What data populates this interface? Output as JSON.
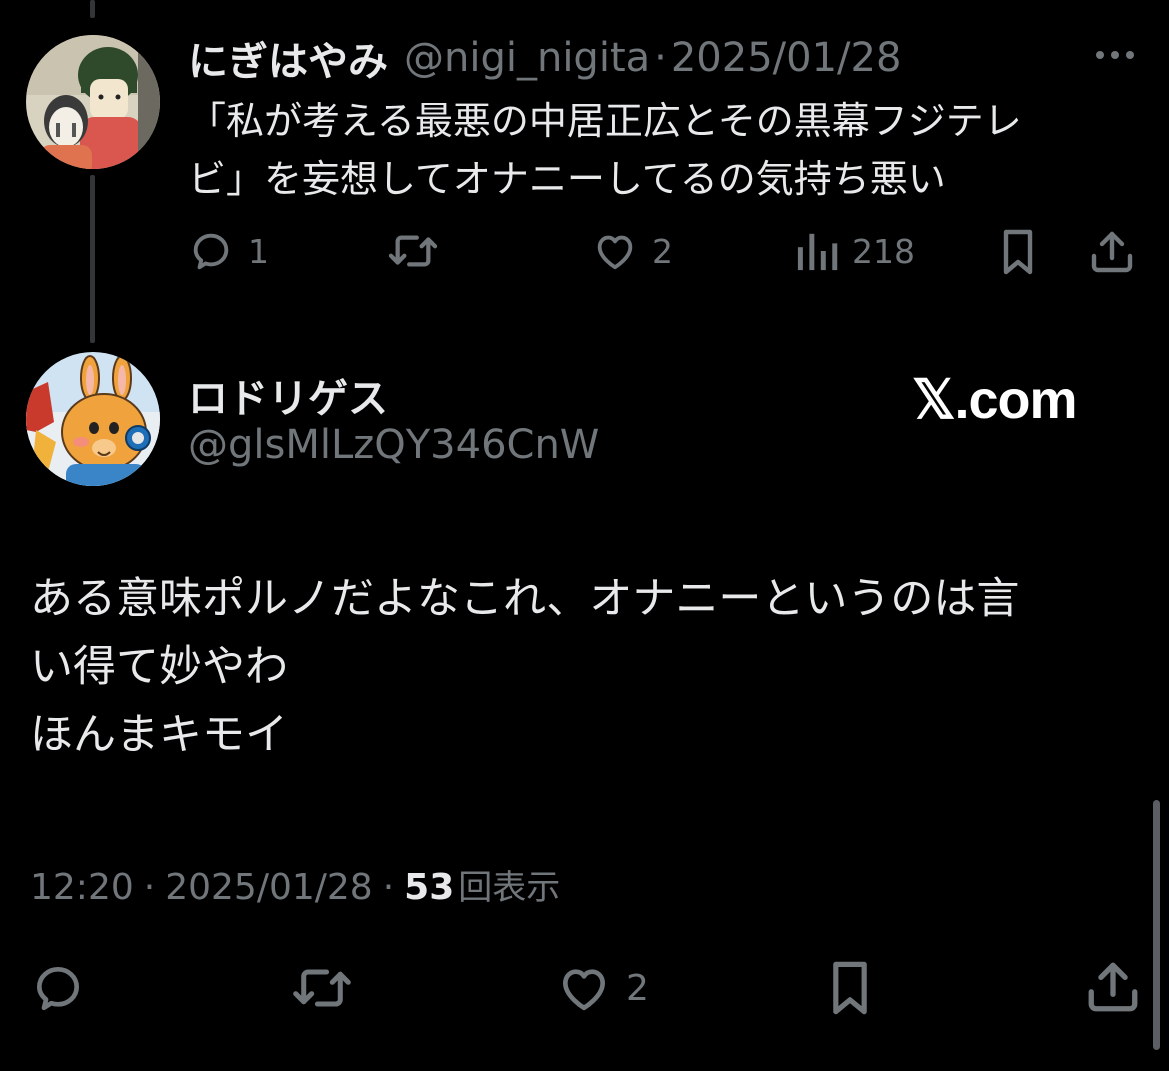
{
  "parent_tweet": {
    "display_name": "にぎはやみ",
    "handle": "@nigi_nigita",
    "separator": "·",
    "date": "2025/01/28",
    "text_lines": [
      "「私が考える最悪の中居正広とその黒幕フジテレ",
      "ビ」を妄想してオナニーしてるの気持ち悪い"
    ],
    "actions": {
      "reply_count": "1",
      "retweet_count": "",
      "like_count": "2",
      "views_count": "218"
    }
  },
  "main_tweet": {
    "display_name": "ロドリゲス",
    "handle": "@glsMlLzQY346CnW",
    "watermark": "𝕏.com",
    "text_lines": [
      "ある意味ポルノだよなこれ、オナニーというのは言",
      "い得て妙やわ",
      "ほんまキモイ"
    ],
    "time": "12:20",
    "separator": "·",
    "date": "2025/01/28",
    "views_number": "53",
    "views_label": "回表示",
    "actions": {
      "like_count": "2"
    }
  },
  "icons": {
    "more": "more-horizontal-icon",
    "reply": "reply-icon",
    "retweet": "retweet-icon",
    "like": "heart-icon",
    "views": "analytics-icon",
    "bookmark": "bookmark-icon",
    "share": "share-icon"
  },
  "colors": {
    "background": "#000000",
    "primary_text": "#e7e9ea",
    "secondary_text": "#71767b",
    "thread_line": "#333639"
  }
}
